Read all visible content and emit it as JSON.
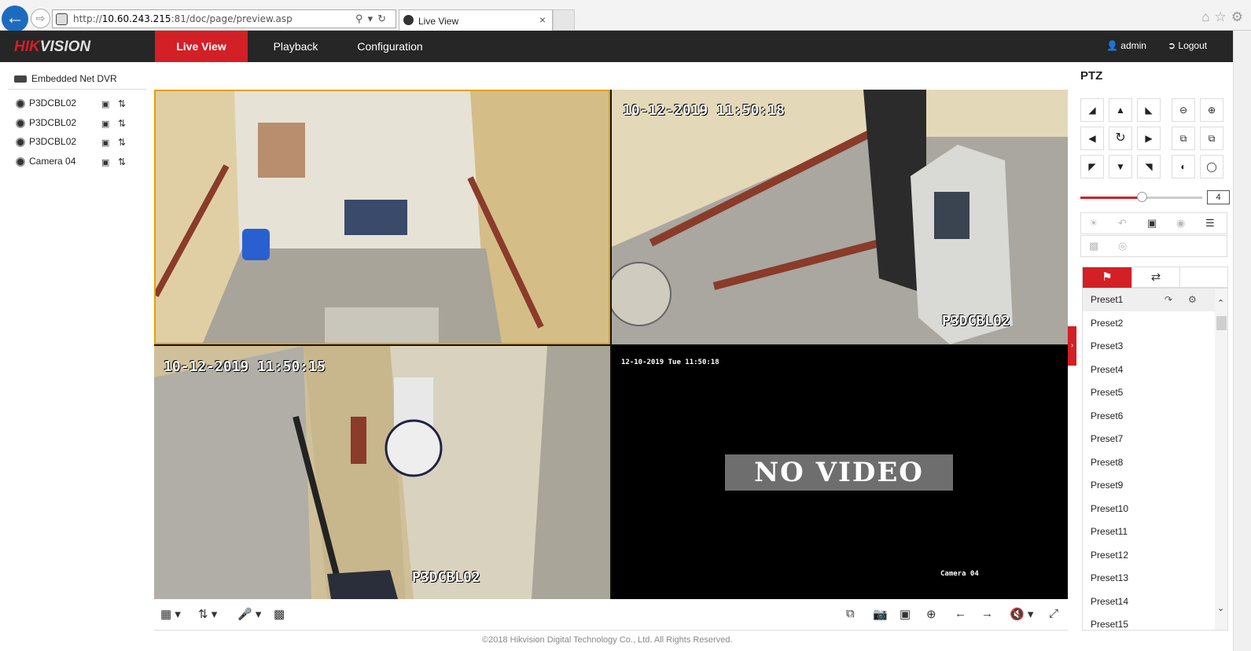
{
  "browser": {
    "url_prefix": "http://",
    "url_host": "10.60.243.215",
    "url_rest": ":81/doc/page/preview.asp",
    "tab_title": "Live View",
    "tab_close": "×",
    "icons": [
      "home-icon",
      "star-icon",
      "gear-icon"
    ]
  },
  "header": {
    "logo_main": "HIK",
    "logo_rest": "VISION",
    "nav": [
      "Live View",
      "Playback",
      "Configuration"
    ],
    "user": "admin",
    "logout": "Logout"
  },
  "tree": {
    "root": "Embedded Net DVR",
    "cameras": [
      "P3DCBL02",
      "P3DCBL02",
      "P3DCBL02",
      "Camera 04"
    ]
  },
  "video": {
    "t2_timestamp": "10-12-2019 11:50:18",
    "t2_name": "P3DCBL02",
    "t3_timestamp": "10-12-2019 11:50:15",
    "t3_name": "P3DCBL02",
    "t4_timestamp": "12-10-2019 Tue 11:50:18",
    "t4_name": "Camera 04",
    "t4_status": "NO VIDEO"
  },
  "footer": "©2018 Hikvision Digital Technology Co., Ltd. All Rights Reserved.",
  "ptz": {
    "title": "PTZ",
    "speed": "4",
    "speed_fraction": 0.5,
    "presets": [
      "Preset1",
      "Preset2",
      "Preset3",
      "Preset4",
      "Preset5",
      "Preset6",
      "Preset7",
      "Preset8",
      "Preset9",
      "Preset10",
      "Preset11",
      "Preset12",
      "Preset13",
      "Preset14",
      "Preset15"
    ]
  },
  "colors": {
    "brand": "#d31f26",
    "header_bg": "#262626",
    "selected_tile": "#e0a400"
  }
}
